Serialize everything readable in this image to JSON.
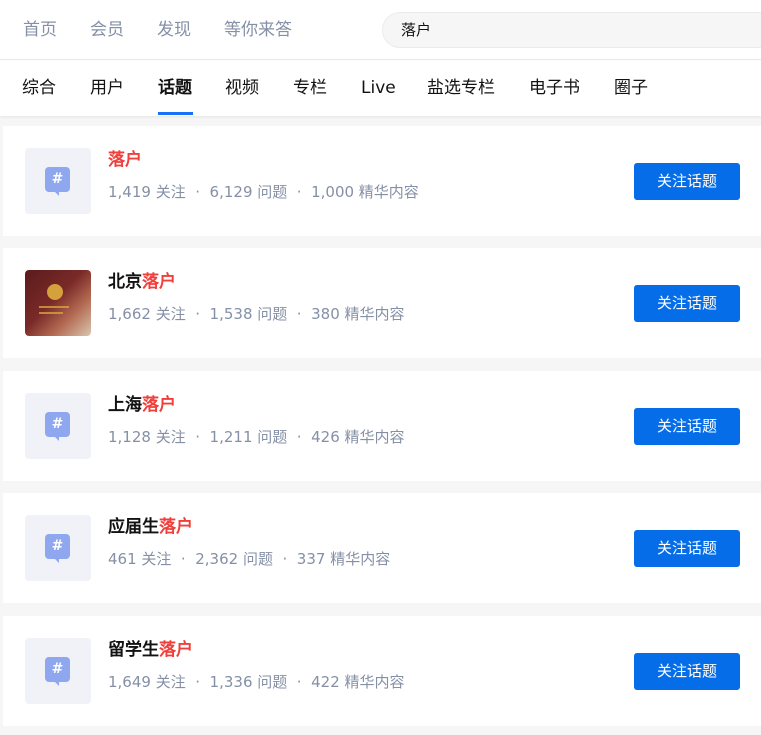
{
  "topnav": {
    "items": [
      "首页",
      "会员",
      "发现",
      "等你来答"
    ]
  },
  "search": {
    "value": "落户"
  },
  "tabs": [
    "综合",
    "用户",
    "话题",
    "视频",
    "专栏",
    "Live",
    "盐选专栏",
    "电子书",
    "圈子"
  ],
  "active_tab": "话题",
  "icons": {
    "topic_placeholder": "hashtag-icon",
    "topic_glyph": "#"
  },
  "colors": {
    "accent": "#056de8",
    "highlight": "#f1403c",
    "meta": "#8590a6"
  },
  "results": [
    {
      "prefix": "",
      "highlight": "落户",
      "meta": "1,419 关注  ·  6,129 问题  ·  1,000 精华内容",
      "button": "关注话题"
    },
    {
      "prefix": "北京",
      "highlight": "落户",
      "meta": "1,662 关注  ·  1,538 问题  ·  380 精华内容",
      "button": "关注话题"
    },
    {
      "prefix": "上海",
      "highlight": "落户",
      "meta": "1,128 关注  ·  1,211 问题  ·  426 精华内容",
      "button": "关注话题"
    },
    {
      "prefix": "应届生",
      "highlight": "落户",
      "meta": "461 关注  ·  2,362 问题  ·  337 精华内容",
      "button": "关注话题"
    },
    {
      "prefix": "留学生",
      "highlight": "落户",
      "meta": "1,649 关注  ·  1,336 问题  ·  422 精华内容",
      "button": "关注话题"
    }
  ]
}
